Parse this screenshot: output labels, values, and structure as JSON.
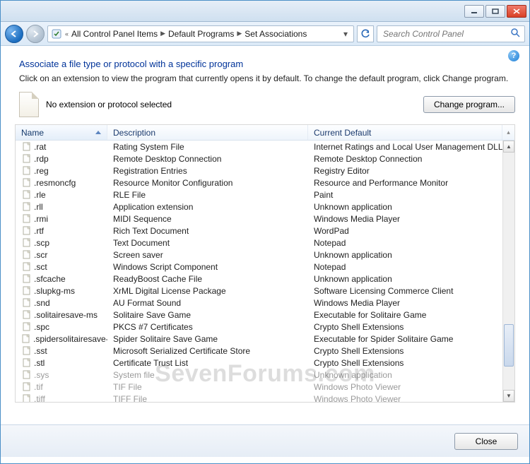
{
  "breadcrumb": {
    "items": [
      "All Control Panel Items",
      "Default Programs",
      "Set Associations"
    ]
  },
  "search": {
    "placeholder": "Search Control Panel"
  },
  "page": {
    "title": "Associate a file type or protocol with a specific program",
    "instructions": "Click on an extension to view the program that currently opens it by default. To change the default program, click Change program.",
    "selection_text": "No extension or protocol selected",
    "change_button": "Change program...",
    "close_button": "Close"
  },
  "columns": {
    "c1": "Name",
    "c2": "Description",
    "c3": "Current Default"
  },
  "rows": [
    {
      "ext": ".rat",
      "desc": "Rating System File",
      "def": "Internet Ratings and Local User Management DLL",
      "disabled": false
    },
    {
      "ext": ".rdp",
      "desc": "Remote Desktop Connection",
      "def": "Remote Desktop Connection",
      "disabled": false
    },
    {
      "ext": ".reg",
      "desc": "Registration Entries",
      "def": "Registry Editor",
      "disabled": false
    },
    {
      "ext": ".resmoncfg",
      "desc": "Resource Monitor Configuration",
      "def": "Resource and Performance Monitor",
      "disabled": false
    },
    {
      "ext": ".rle",
      "desc": "RLE File",
      "def": "Paint",
      "disabled": false
    },
    {
      "ext": ".rll",
      "desc": "Application extension",
      "def": "Unknown application",
      "disabled": false
    },
    {
      "ext": ".rmi",
      "desc": "MIDI Sequence",
      "def": "Windows Media Player",
      "disabled": false
    },
    {
      "ext": ".rtf",
      "desc": "Rich Text Document",
      "def": "WordPad",
      "disabled": false
    },
    {
      "ext": ".scp",
      "desc": "Text Document",
      "def": "Notepad",
      "disabled": false
    },
    {
      "ext": ".scr",
      "desc": "Screen saver",
      "def": "Unknown application",
      "disabled": false
    },
    {
      "ext": ".sct",
      "desc": "Windows Script Component",
      "def": "Notepad",
      "disabled": false
    },
    {
      "ext": ".sfcache",
      "desc": "ReadyBoost Cache File",
      "def": "Unknown application",
      "disabled": false
    },
    {
      "ext": ".slupkg-ms",
      "desc": "XrML Digital License Package",
      "def": "Software Licensing Commerce Client",
      "disabled": false
    },
    {
      "ext": ".snd",
      "desc": "AU Format Sound",
      "def": "Windows Media Player",
      "disabled": false
    },
    {
      "ext": ".solitairesave-ms",
      "desc": "Solitaire Save Game",
      "def": "Executable for Solitaire Game",
      "disabled": false
    },
    {
      "ext": ".spc",
      "desc": "PKCS #7 Certificates",
      "def": "Crypto Shell Extensions",
      "disabled": false
    },
    {
      "ext": ".spidersolitairesave-ms",
      "desc": "Spider Solitaire Save Game",
      "def": "Executable for Spider Solitaire Game",
      "disabled": false
    },
    {
      "ext": ".sst",
      "desc": "Microsoft Serialized Certificate Store",
      "def": "Crypto Shell Extensions",
      "disabled": false
    },
    {
      "ext": ".stl",
      "desc": "Certificate Trust List",
      "def": "Crypto Shell Extensions",
      "disabled": false
    },
    {
      "ext": ".sys",
      "desc": "System file",
      "def": "Unknown application",
      "disabled": true
    },
    {
      "ext": ".tif",
      "desc": "TIF File",
      "def": "Windows Photo Viewer",
      "disabled": true
    },
    {
      "ext": ".tiff",
      "desc": "TIFF File",
      "def": "Windows Photo Viewer",
      "disabled": true
    }
  ],
  "watermark": "SevenForums.com"
}
